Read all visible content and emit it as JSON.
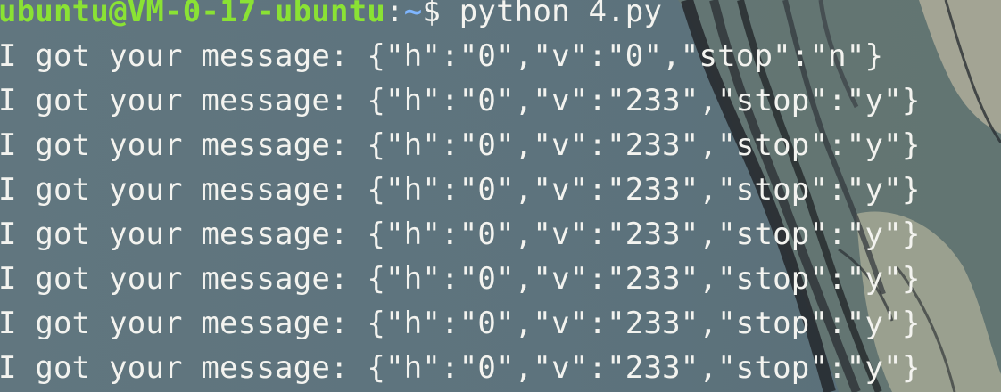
{
  "terminal": {
    "prompt": {
      "user_host": "ubuntu@VM-0-17-ubuntu",
      "separator": ":",
      "path": "~",
      "symbol": "$",
      "command": "python 4.py"
    },
    "output_lines": [
      "I got your message: {\"h\":\"0\",\"v\":\"0\",\"stop\":\"n\"}",
      "I got your message: {\"h\":\"0\",\"v\":\"233\",\"stop\":\"y\"}",
      "I got your message: {\"h\":\"0\",\"v\":\"233\",\"stop\":\"y\"}",
      "I got your message: {\"h\":\"0\",\"v\":\"233\",\"stop\":\"y\"}",
      "I got your message: {\"h\":\"0\",\"v\":\"233\",\"stop\":\"y\"}",
      "I got your message: {\"h\":\"0\",\"v\":\"233\",\"stop\":\"y\"}",
      "I got your message: {\"h\":\"0\",\"v\":\"233\",\"stop\":\"y\"}",
      "I got your message: {\"h\":\"0\",\"v\":\"233\",\"stop\":\"y\"}"
    ]
  },
  "colors": {
    "background": "#5f7480",
    "text": "#f3f3ef",
    "user_host": "#8ae234",
    "path": "#7fb6ff"
  }
}
